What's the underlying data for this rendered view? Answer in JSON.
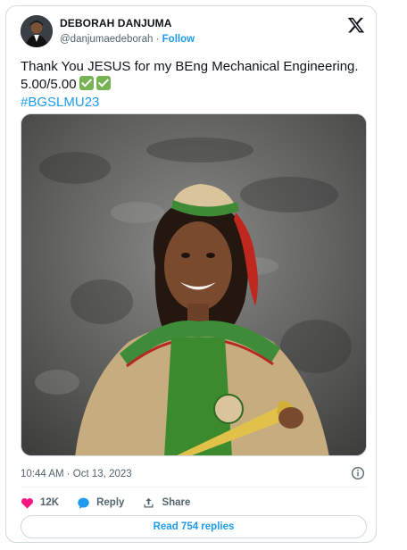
{
  "author": {
    "name": "DEBORAH DANJUMA",
    "handle": "@danjumaedeborah",
    "separator": "·",
    "follow_label": "Follow"
  },
  "tweet": {
    "line1": "Thank You JESUS for my BEng Mechanical Engineering.",
    "line2": "5.00/5.00",
    "hashtag": "#BGSLMU23",
    "check_icon": "white-check-mark-emoji"
  },
  "meta": {
    "timestamp": "10:44 AM · Oct 13, 2023"
  },
  "actions": {
    "likes": "12K",
    "reply_label": "Reply",
    "share_label": "Share",
    "read_replies_label": "Read 754 replies"
  },
  "colors": {
    "accent": "#1d9bf0",
    "like": "#f91880",
    "text": "#0f1419",
    "muted": "#536471",
    "check": "#77b255"
  }
}
